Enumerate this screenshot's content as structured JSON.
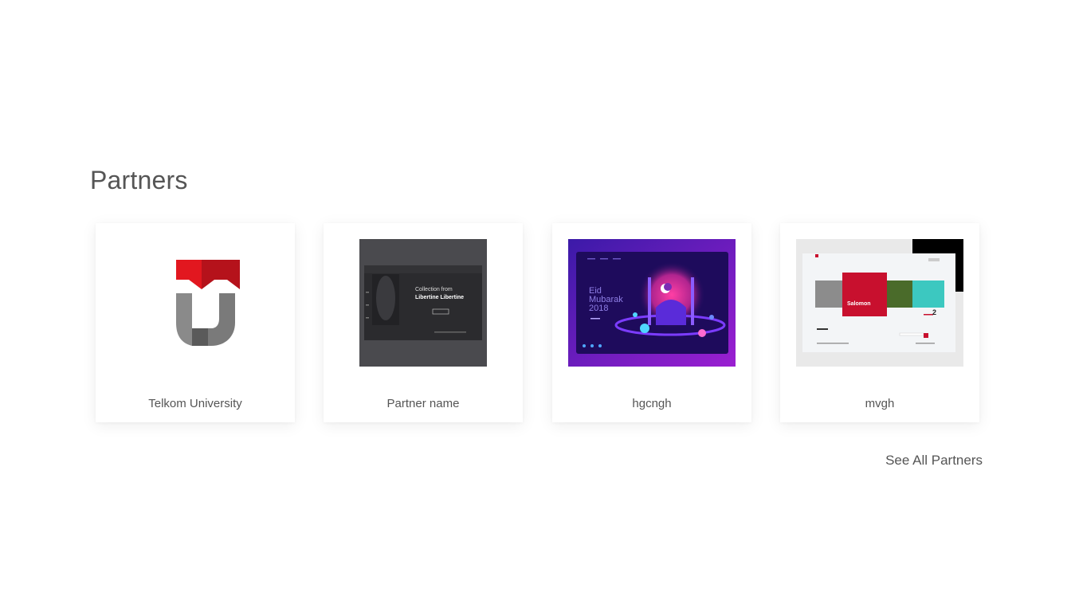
{
  "section": {
    "title": "Partners",
    "see_all_label": "See All Partners"
  },
  "partners": [
    {
      "name": "Telkom University",
      "image": {
        "kind": "logo",
        "colors": {
          "red": "#e2171f",
          "dark_red": "#b5121b",
          "grey": "#7a7a7a",
          "dark_grey": "#5a5a5a"
        }
      }
    },
    {
      "name": "Partner name",
      "image": {
        "kind": "web-design-mockup-dark",
        "headline_1": "Collection from",
        "headline_2": "Libertine Libertine",
        "colors": {
          "bg": "#4a4a4e",
          "panel": "#2b2b2e"
        }
      }
    },
    {
      "name": "hgcngh",
      "image": {
        "kind": "eid-illustration",
        "headline_1": "Eid",
        "headline_2": "Mubarak",
        "headline_3": "2018",
        "colors": {
          "bg1": "#3b1aa8",
          "bg2": "#9b1fd1",
          "panel": "#1e0b5c",
          "accent": "#ff3fa4"
        }
      }
    },
    {
      "name": "mvgh",
      "image": {
        "kind": "web-design-mockup-light",
        "headline": "Salomon",
        "counter": "2",
        "colors": {
          "red": "#c8102e",
          "green": "#4a6b2a",
          "teal": "#3cc8c0",
          "black": "#000000"
        }
      }
    }
  ]
}
